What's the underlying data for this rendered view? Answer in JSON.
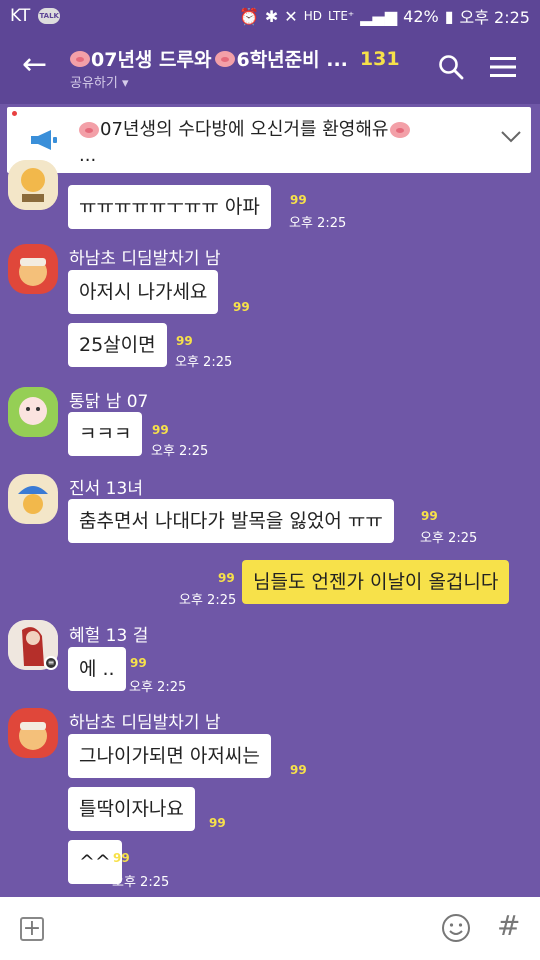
{
  "status_bar": {
    "carrier": "KT",
    "talk_badge": "TALK",
    "hd": "HD",
    "lte": "LTE⁺",
    "battery": "42%",
    "time": "오후 2:25"
  },
  "header": {
    "title_part1": "07년생 드루와",
    "title_part2": "6학년준비 ...",
    "member_count": "131",
    "subtitle": "공유하기 ▾"
  },
  "notice": {
    "line1": "07년생의 수다방에 오신거를 환영해유",
    "line2": "..."
  },
  "messages": [
    {
      "text": "ㅠㅠㅠㅠㅠㅜㅠㅠ 아파",
      "unread": "99",
      "time": "오후 2:25"
    },
    {
      "sender": "하남초 디딤발차기 남",
      "text": "아저시 나가세요",
      "unread": "99"
    },
    {
      "text": "25살이면",
      "unread": "99",
      "time": "오후 2:25"
    },
    {
      "sender": "통닭 남 07",
      "text": "ㅋㅋㅋ",
      "unread": "99",
      "time": "오후 2:25"
    },
    {
      "sender": "진서 13녀",
      "text": "춤추면서 나대다가 발목을 잃었어 ㅠㅠ",
      "unread": "99",
      "time": "오후 2:25"
    },
    {
      "text": "님들도 언젠가 이날이 올겁니다",
      "unread": "99",
      "time": "오후 2:25"
    },
    {
      "sender": "혜헐 13 걸",
      "text": "에 ..",
      "unread": "99",
      "time": "오후 2:25"
    },
    {
      "sender": "하남초 디딤발차기 남",
      "text": "그나이가되면 아저씨는",
      "unread": "99"
    },
    {
      "text": "틀딱이자나요",
      "unread": "99"
    },
    {
      "text": "^^",
      "unread": "99",
      "time": "오후 2:25"
    }
  ],
  "colors": {
    "background": "#6f57a7",
    "header": "#5d4696",
    "my_bubble": "#f7e14a",
    "unread": "#f7e14a"
  }
}
